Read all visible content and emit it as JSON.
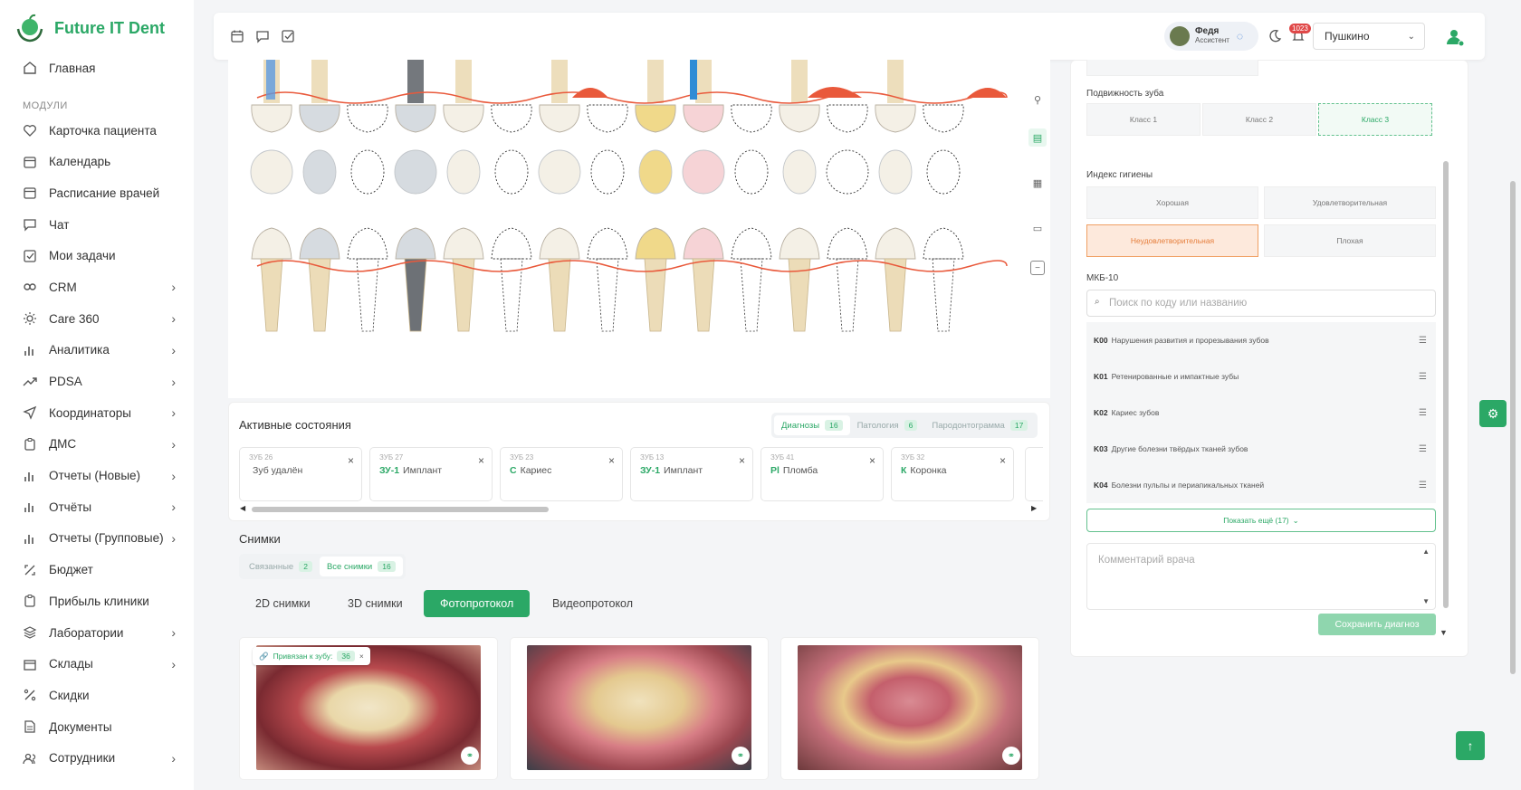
{
  "app": {
    "name": "Future IT Dent"
  },
  "sidebar": {
    "home": "Главная",
    "section": "МОДУЛИ",
    "items": [
      {
        "label": "Карточка пациента",
        "icon": "heart-icon",
        "chev": false
      },
      {
        "label": "Календарь",
        "icon": "calendar-icon",
        "chev": false
      },
      {
        "label": "Расписание врачей",
        "icon": "calendar-icon",
        "chev": false
      },
      {
        "label": "Чат",
        "icon": "chat-icon",
        "chev": false
      },
      {
        "label": "Мои задачи",
        "icon": "checkbox-icon",
        "chev": false
      },
      {
        "label": "CRM",
        "icon": "crm-icon",
        "chev": true
      },
      {
        "label": "Care 360",
        "icon": "sun-icon",
        "chev": true
      },
      {
        "label": "Аналитика",
        "icon": "bars-icon",
        "chev": true
      },
      {
        "label": "PDSA",
        "icon": "trend-icon",
        "chev": true
      },
      {
        "label": "Координаторы",
        "icon": "send-icon",
        "chev": true
      },
      {
        "label": "ДМС",
        "icon": "clipboard-icon",
        "chev": true
      },
      {
        "label": "Отчеты (Новые)",
        "icon": "bars-icon",
        "chev": true
      },
      {
        "label": "Отчёты",
        "icon": "bars-icon",
        "chev": true
      },
      {
        "label": "Отчеты (Групповые)",
        "icon": "bars-icon",
        "chev": true
      },
      {
        "label": "Бюджет",
        "icon": "wallet-icon",
        "chev": false
      },
      {
        "label": "Прибыль клиники",
        "icon": "clipboard-icon",
        "chev": false
      },
      {
        "label": "Лаборатории",
        "icon": "layers-icon",
        "chev": true
      },
      {
        "label": "Склады",
        "icon": "box-icon",
        "chev": true
      },
      {
        "label": "Скидки",
        "icon": "percent-icon",
        "chev": false
      },
      {
        "label": "Документы",
        "icon": "document-icon",
        "chev": false
      },
      {
        "label": "Сотрудники",
        "icon": "users-icon",
        "chev": true
      }
    ]
  },
  "topbar": {
    "user_name": "Федя",
    "user_role": "Ассистент",
    "notif_count": "1023",
    "clinic": "Пушкино"
  },
  "active": {
    "title": "Активные состояния",
    "tabs": [
      {
        "label": "Диагнозы",
        "count": "16"
      },
      {
        "label": "Патология",
        "count": "6"
      },
      {
        "label": "Пародонтограмма",
        "count": "17"
      }
    ],
    "cards": [
      {
        "tooth": "ЗУБ 26",
        "code": "",
        "text": "Зуб удалён"
      },
      {
        "tooth": "ЗУБ 27",
        "code": "ЗУ-1",
        "text": "Имплант"
      },
      {
        "tooth": "ЗУБ 23",
        "code": "С",
        "text": "Кариес"
      },
      {
        "tooth": "ЗУБ 13",
        "code": "ЗУ-1",
        "text": "Имплант"
      },
      {
        "tooth": "ЗУБ 41",
        "code": "Pl",
        "text": "Пломба"
      },
      {
        "tooth": "ЗУБ 32",
        "code": "К",
        "text": "Коронка"
      }
    ]
  },
  "photos": {
    "title": "Снимки",
    "filter": [
      {
        "label": "Связанные",
        "count": "2"
      },
      {
        "label": "Все снимки",
        "count": "16"
      }
    ],
    "types": [
      "2D снимки",
      "3D снимки",
      "Фотопротокол",
      "Видеопротокол"
    ],
    "linked_label": "Привязан к зубу:",
    "linked_tooth": "36"
  },
  "panel": {
    "mobility_label": "Подвижность зуба",
    "mobility": [
      "Класс 1",
      "Класс 2",
      "Класс 3"
    ],
    "hygiene_label": "Индекс гигиены",
    "hygiene": [
      "Хорошая",
      "Удовлетворительная",
      "Неудовлетворительная",
      "Плохая"
    ],
    "mkb_label": "МКБ-10",
    "search_placeholder": "Поиск по коду или названию",
    "mkb": [
      {
        "code": "K00",
        "text": "Нарушения развития и прорезывания зубов"
      },
      {
        "code": "K01",
        "text": "Ретенированные и импактные зубы"
      },
      {
        "code": "K02",
        "text": "Кариес зубов"
      },
      {
        "code": "K03",
        "text": "Другие болезни твёрдых тканей зубов"
      },
      {
        "code": "K04",
        "text": "Болезни пульпы и периапикальных тканей"
      }
    ],
    "show_more": "Показать ещё (17)",
    "comment_placeholder": "Комментарий врача",
    "save": "Сохранить диагноз"
  },
  "colors": {
    "accent": "#2ba866",
    "warning": "#e67e3b",
    "gum": "#e9593b"
  }
}
